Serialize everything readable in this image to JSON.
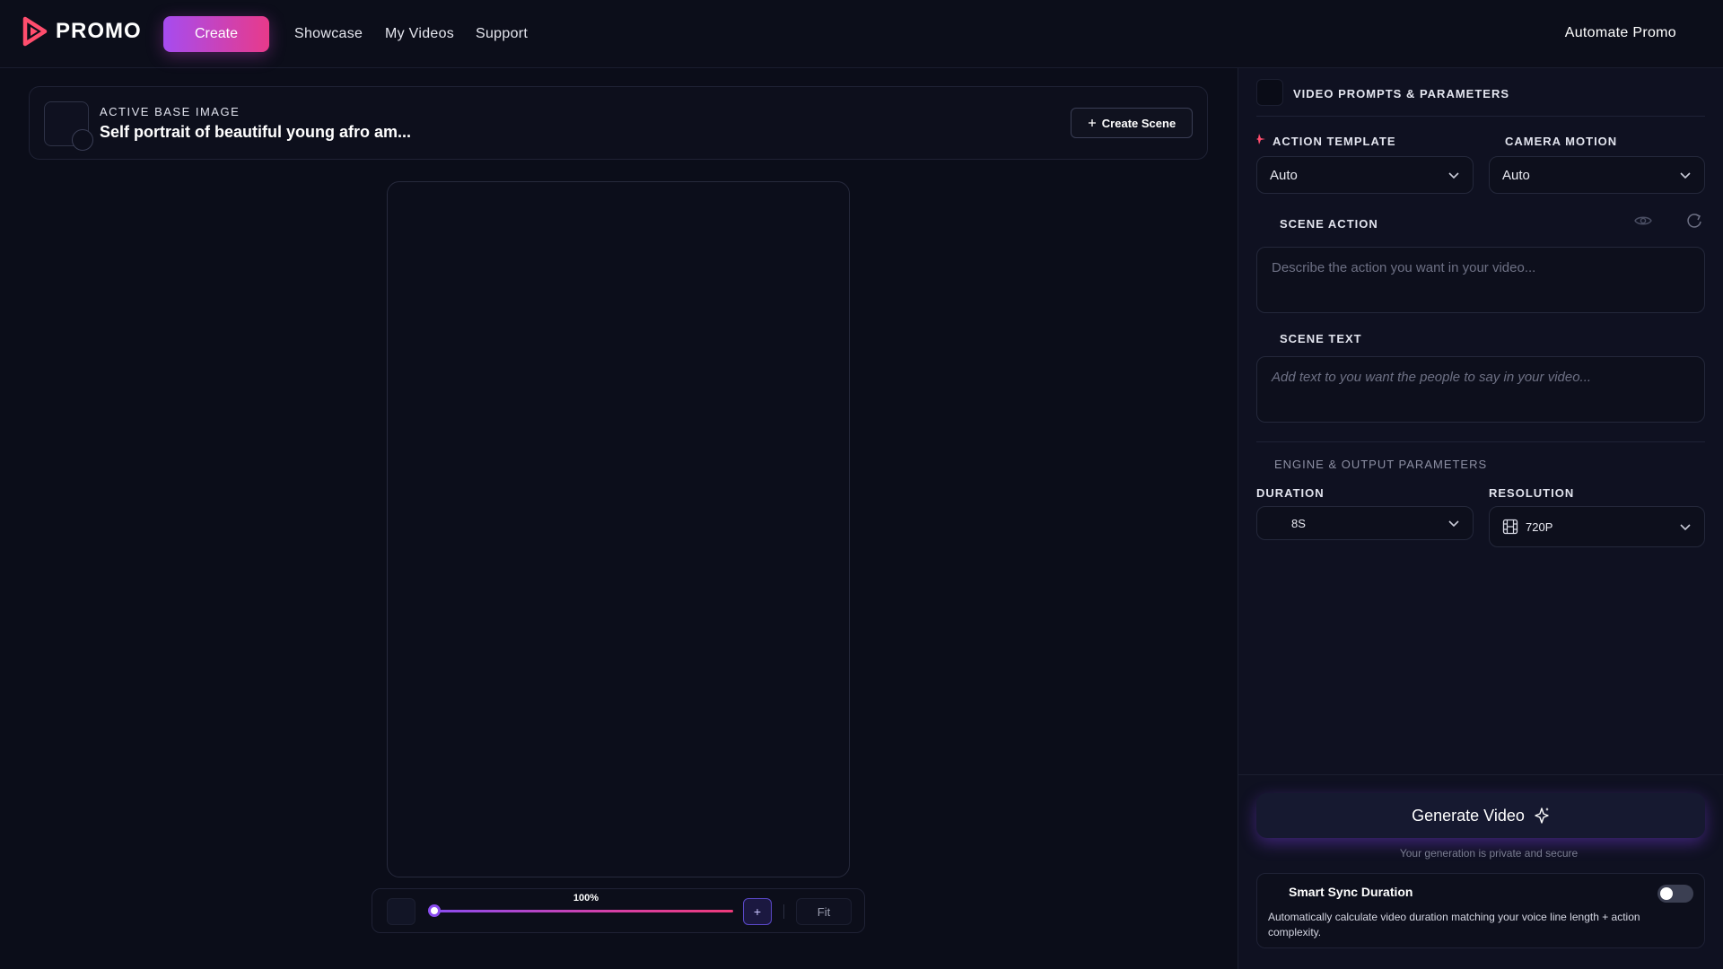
{
  "app": {
    "brand": "PROMO",
    "brand_color": "#ff4d6d"
  },
  "nav": {
    "create_label": "Create",
    "links": [
      "Showcase",
      "My Videos",
      "Support"
    ],
    "automate_label": "Automate Promo"
  },
  "base_image": {
    "label": "ACTIVE BASE IMAGE",
    "title": "Self portrait of beautiful young afro am...",
    "create_scene_label": "Create Scene",
    "create_scene_icon": "plus-icon"
  },
  "zoom": {
    "percent_label": "100%",
    "level": 0.0,
    "plus_label": "+",
    "fit_label": "Fit"
  },
  "panel": {
    "header_title": "VIDEO PROMPTS & PARAMETERS",
    "action_template": {
      "label": "ACTION TEMPLATE",
      "value": "Auto",
      "icon": "sparkle-icon"
    },
    "camera_motion": {
      "label": "CAMERA MOTION",
      "value": "Auto"
    },
    "scene_action": {
      "label": "SCENE ACTION",
      "placeholder": "Describe the action you want in your video..."
    },
    "scene_text": {
      "label": "SCENE TEXT",
      "placeholder": "Add text to you want the people to say in your video..."
    },
    "engine_section": "ENGINE & OUTPUT PARAMETERS",
    "duration": {
      "label": "DURATION",
      "value": "8S"
    },
    "resolution": {
      "label": "RESOLUTION",
      "value": "720P",
      "icon": "film-icon"
    },
    "generate": {
      "label": "Generate Video",
      "note": "Your generation is private and secure"
    },
    "smart_sync": {
      "title": "Smart Sync Duration",
      "description": "Automatically calculate video duration matching your voice line length + action complexity.",
      "enabled": false
    }
  },
  "colors": {
    "accent_purple": "#a64cf0",
    "accent_pink": "#e83a8a",
    "background": "#0b0d19"
  }
}
